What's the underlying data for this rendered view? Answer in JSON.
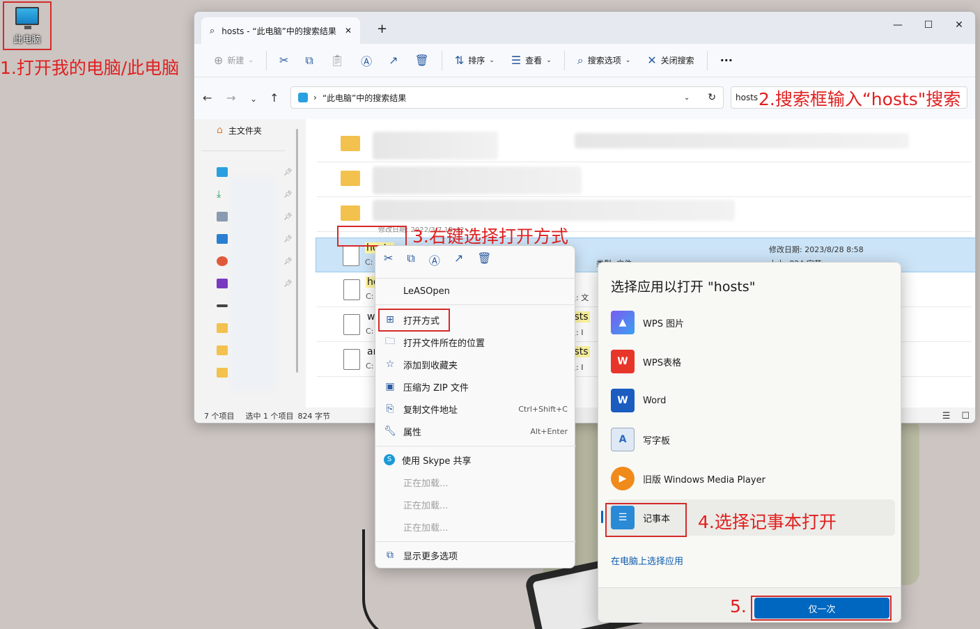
{
  "desktop": {
    "icon_label": "此电脑"
  },
  "annotations": {
    "step1": "1.打开我的电脑/此电脑",
    "step2": "2.搜索框输入“hosts\"搜索",
    "step3": "3.右键选择打开方式",
    "step4": "4.选择记事本打开",
    "step5": "5."
  },
  "explorer": {
    "tab_title": "hosts - “此电脑”中的搜索结果",
    "tab_close": "✕",
    "tab_add": "+",
    "toolbar": {
      "new": "新建",
      "sort": "排序",
      "view": "查看",
      "search_options": "搜索选项",
      "close_search": "关闭搜索",
      "more": "···"
    },
    "address": "“此电脑”中的搜索结果",
    "search_value": "hosts",
    "sidebar": {
      "home": "主文件夹"
    },
    "partial_date": "修改日期: 2022/3/7 13:42",
    "files": [
      {
        "name": "hosts",
        "path": "C:",
        "type": "类型: 文件",
        "date": "修改日期: 2023/8/28 8:58",
        "size": "大小: 824 字节"
      },
      {
        "name": "ho",
        "path": "C:",
        "type": "类型: 文"
      },
      {
        "name": "w",
        "path": "C:",
        "type": "类型: I",
        "extra": "hosts"
      },
      {
        "name": "ar",
        "path": "C:",
        "type": "类型: I",
        "extra": "hosts"
      }
    ],
    "status": {
      "count": "7 个项目",
      "selected": "选中 1 个项目",
      "size": "824 字节"
    }
  },
  "context_menu": {
    "items": [
      {
        "label": "LeASOpen"
      },
      {
        "label": "打开方式"
      },
      {
        "label": "打开文件所在的位置"
      },
      {
        "label": "添加到收藏夹"
      },
      {
        "label": "压缩为 ZIP 文件"
      },
      {
        "label": "复制文件地址",
        "shortcut": "Ctrl+Shift+C"
      },
      {
        "label": "属性",
        "shortcut": "Alt+Enter"
      },
      {
        "label": "使用 Skype 共享"
      },
      {
        "label": "正在加载..."
      },
      {
        "label": "正在加载..."
      },
      {
        "label": "正在加载..."
      },
      {
        "label": "显示更多选项"
      }
    ]
  },
  "open_with": {
    "title": "选择应用以打开 \"hosts\"",
    "apps": [
      {
        "label": "WPS 图片",
        "icon": "wps-picture-icon"
      },
      {
        "label": "WPS表格",
        "icon": "wps-sheet-icon"
      },
      {
        "label": "Word",
        "icon": "word-icon"
      },
      {
        "label": "写字板",
        "icon": "wordpad-icon"
      },
      {
        "label": "旧版 Windows Media Player",
        "icon": "media-player-icon"
      },
      {
        "label": "记事本",
        "icon": "notepad-icon"
      }
    ],
    "choose_link": "在电脑上选择应用",
    "once_button": "仅一次"
  },
  "colors": {
    "accent": "#0067c0",
    "annotation": "#e02020",
    "selection": "#cce4f7"
  }
}
